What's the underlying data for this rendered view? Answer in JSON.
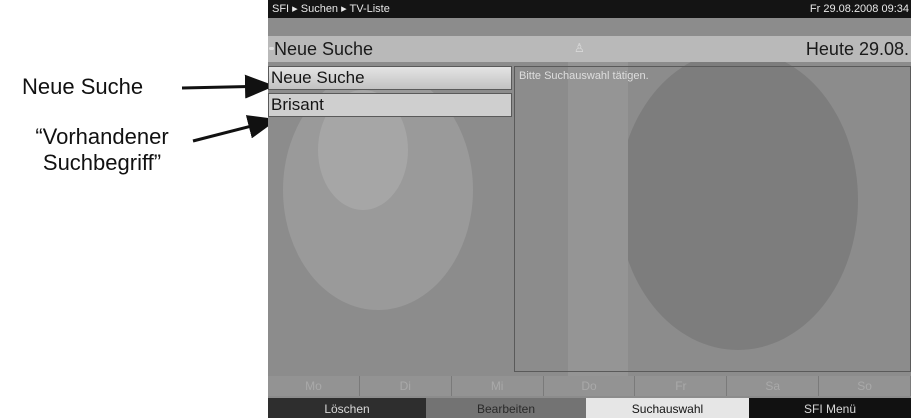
{
  "annotations": {
    "label1": "Neue Suche",
    "label2_line1": "“Vorhandener",
    "label2_line2": "Suchbegriff”"
  },
  "screen": {
    "breadcrumb": "SFI ▸ Suchen ▸ TV-Liste",
    "clock": "Fr 29.08.2008 09:34",
    "header_title": "Neue Suche",
    "header_date": "Heute 29.08.",
    "header_icon": "person-icon",
    "list": [
      {
        "label": "Neue Suche",
        "selected": true
      },
      {
        "label": "Brisant",
        "selected": false
      }
    ],
    "info_text": "Bitte Suchauswahl tätigen.",
    "days": [
      "Mo",
      "Di",
      "Mi",
      "Do",
      "Fr",
      "Sa",
      "So"
    ],
    "buttons": {
      "red": "Löschen",
      "green": "Bearbeiten",
      "yellow": "Suchauswahl",
      "blue": "SFI Menü"
    }
  }
}
